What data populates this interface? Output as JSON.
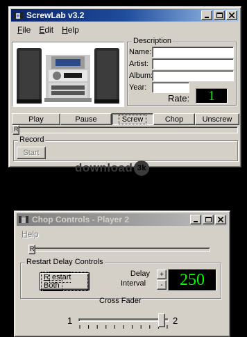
{
  "main_window": {
    "title": "ScrewLab v3.2",
    "menu": [
      {
        "label": "File",
        "mnemonic": "F",
        "rest": "ile"
      },
      {
        "label": "Edit",
        "mnemonic": "E",
        "rest": "dit"
      },
      {
        "label": "Help",
        "mnemonic": "H",
        "rest": "elp"
      }
    ],
    "description": {
      "group_label": "Description",
      "name_label": "Name:",
      "artist_label": "Artist:",
      "album_label": "Album:",
      "year_label": "Year:",
      "name_value": "",
      "artist_value": "",
      "album_value": "",
      "year_value": "",
      "rate_label": "Rate:",
      "rate_value": "1"
    },
    "transport": {
      "play": "Play",
      "pause": "Pause",
      "screw": "Screw",
      "chop": "Chop",
      "unscrew": "Unscrew",
      "selected": "Screw"
    },
    "seek_thumb_glyph": "R",
    "seek_position": 0,
    "record": {
      "group_label": "Record",
      "start_label": "Start"
    }
  },
  "watermark": {
    "text": "download",
    "badge": "3k"
  },
  "chop_window": {
    "title": "Chop Controls - Player 2",
    "menu": [
      {
        "label": "Help",
        "mnemonic": "H",
        "rest": "elp"
      }
    ],
    "slider_thumb_glyph": "R",
    "slider_position": 0,
    "restart": {
      "group_label": "Restart Delay Controls",
      "button_mnemonic": "R",
      "button_rest": "estart Both",
      "delay_label_line1": "Delay",
      "delay_label_line2": "Interval",
      "plus": "+",
      "minus": "-",
      "delay_value": "250"
    },
    "cross_fader": {
      "label": "Cross Fader",
      "left_label": "1",
      "right_label": "2",
      "position": 0.96
    }
  },
  "colors": {
    "face": "#d4d0c8",
    "active_title": "#0a246a",
    "lcd_text": "#00ff00"
  }
}
